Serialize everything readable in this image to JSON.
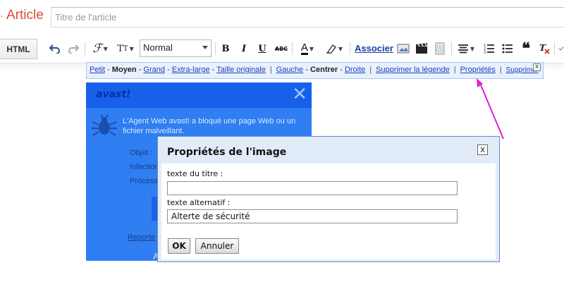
{
  "header": {
    "bullet": "·",
    "title": "Article",
    "title_placeholder": "Titre de l'article"
  },
  "toolbar": {
    "html_label": "HTML",
    "font_value": "Normal",
    "bold": "B",
    "italic": "I",
    "underline": "U",
    "strike": "ABC",
    "associate_label": "Associer",
    "icons": [
      "undo-icon",
      "redo-icon",
      "font-family-icon",
      "font-size-icon",
      "bold-icon",
      "italic-icon",
      "underline-icon",
      "strikethrough-icon",
      "text-color-icon",
      "highlight-icon",
      "insert-image-icon",
      "insert-video-icon",
      "insert-jump-break-icon",
      "align-icon",
      "numbered-list-icon",
      "bulleted-list-icon",
      "quote-icon",
      "remove-format-icon"
    ]
  },
  "image_bar": {
    "sizes": [
      "Petit",
      "Moyen",
      "Grand",
      "Extra-large",
      "Taille originale"
    ],
    "current_size": "Moyen",
    "positions": [
      "Gauche",
      "Centrer",
      "Droite"
    ],
    "current_position": "Centrer",
    "remove_caption": "Supprimer la légende",
    "properties": "Propriétés",
    "remove": "Supprimer",
    "close": "x"
  },
  "avast": {
    "logo": "avast!",
    "close": "✕",
    "message": "L'Agent Web avast! a bloqué une page Web ou un fichier malveillant.",
    "object_label": "Objet :",
    "infection_label": "Infection",
    "process_label": "Process",
    "report_link": "Reporte",
    "footer_letter": "A"
  },
  "dialog": {
    "title": "Propriétés de l'image",
    "close": "x",
    "title_text_label": "texte du titre :",
    "title_text_value": "",
    "alt_text_label": "texte alternatif :",
    "alt_text_value": "Alterte de sécurité",
    "ok_label": "OK",
    "cancel_label": "Annuler"
  },
  "colors": {
    "title_accent": "#dd4b39",
    "link": "#1e3fbb",
    "annotation_arrow": "#e020d8",
    "avast_blue": "#2f7ef2"
  }
}
